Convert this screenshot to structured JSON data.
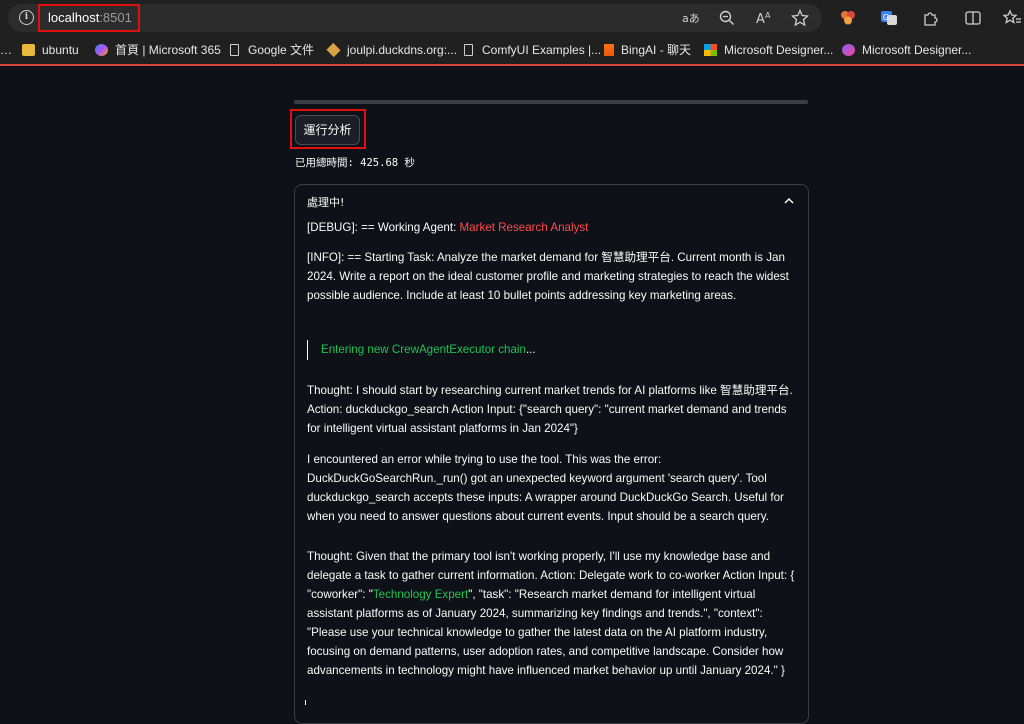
{
  "browser": {
    "url_host": "localhost",
    "url_port": ":8501",
    "bookmarks": [
      {
        "label": "ubuntu",
        "icon": "folder-icon"
      },
      {
        "label": "首頁 | Microsoft 365",
        "icon": "copilot-icon"
      },
      {
        "label": "Google 文件",
        "icon": "page-icon"
      },
      {
        "label": "joulpi.duckdns.org:...",
        "icon": "cube-icon"
      },
      {
        "label": "ComfyUI Examples |...",
        "icon": "page-icon"
      },
      {
        "label": "BingAI - 聊天",
        "icon": "bing-icon"
      },
      {
        "label": "Microsoft Designer...",
        "icon": "microsoft-icon"
      },
      {
        "label": "Microsoft Designer...",
        "icon": "designer-icon"
      }
    ],
    "toolbar_icons": [
      "read-aloud-icon",
      "zoom-icon",
      "text-size-icon",
      "favorite-star-icon",
      "extension-icon",
      "translate-icon",
      "puzzle-icon",
      "split-screen-icon",
      "favorites-icon"
    ]
  },
  "app": {
    "run_button": "運行分析",
    "elapsed_label": "已用總時間:",
    "elapsed_value": "425.68",
    "elapsed_unit": "秒",
    "status_title": "處理中!"
  },
  "log": {
    "debug_prefix": "[DEBUG]: == Working Agent: ",
    "debug_agent": "Market Research Analyst",
    "info_task": "[INFO]: == Starting Task: Analyze the market demand for 智慧助理平台. Current month is Jan 2024. Write a report on the ideal customer profile and marketing strategies to reach the widest possible audience. Include at least 10 bullet points addressing key marketing areas.",
    "chain_text": "Entering new CrewAgentExecutor chain",
    "chain_dots": "...",
    "thought_1": "Thought: I should start by researching current market trends for AI platforms like 智慧助理平台. Action: duckduckgo_search Action Input: {\"search query\": \"current market demand and trends for intelligent virtual assistant platforms in Jan 2024\"}",
    "error_text": "I encountered an error while trying to use the tool. This was the error: DuckDuckGoSearchRun._run() got an unexpected keyword argument 'search query'. Tool duckduckgo_search accepts these inputs: A wrapper around DuckDuckGo Search. Useful for when you need to answer questions about current events. Input should be a search query.",
    "thought_2_before": "Thought: Given that the primary tool isn't working properly, I'll use my knowledge base and delegate a task to gather current information. Action: Delegate work to co-worker Action Input: { \"coworker\": \"",
    "thought_2_coworker": "Technology Expert",
    "thought_2_after": "\", \"task\": \"Research market demand for intelligent virtual assistant platforms as of January 2024, summarizing key findings and trends.\", \"context\": \"Please use your technical knowledge to gather the latest data on the AI platform industry, focusing on demand patterns, user adoption rates, and competitive landscape. Consider how advancements in technology might have influenced market behavior up until January 2024.\" }"
  }
}
